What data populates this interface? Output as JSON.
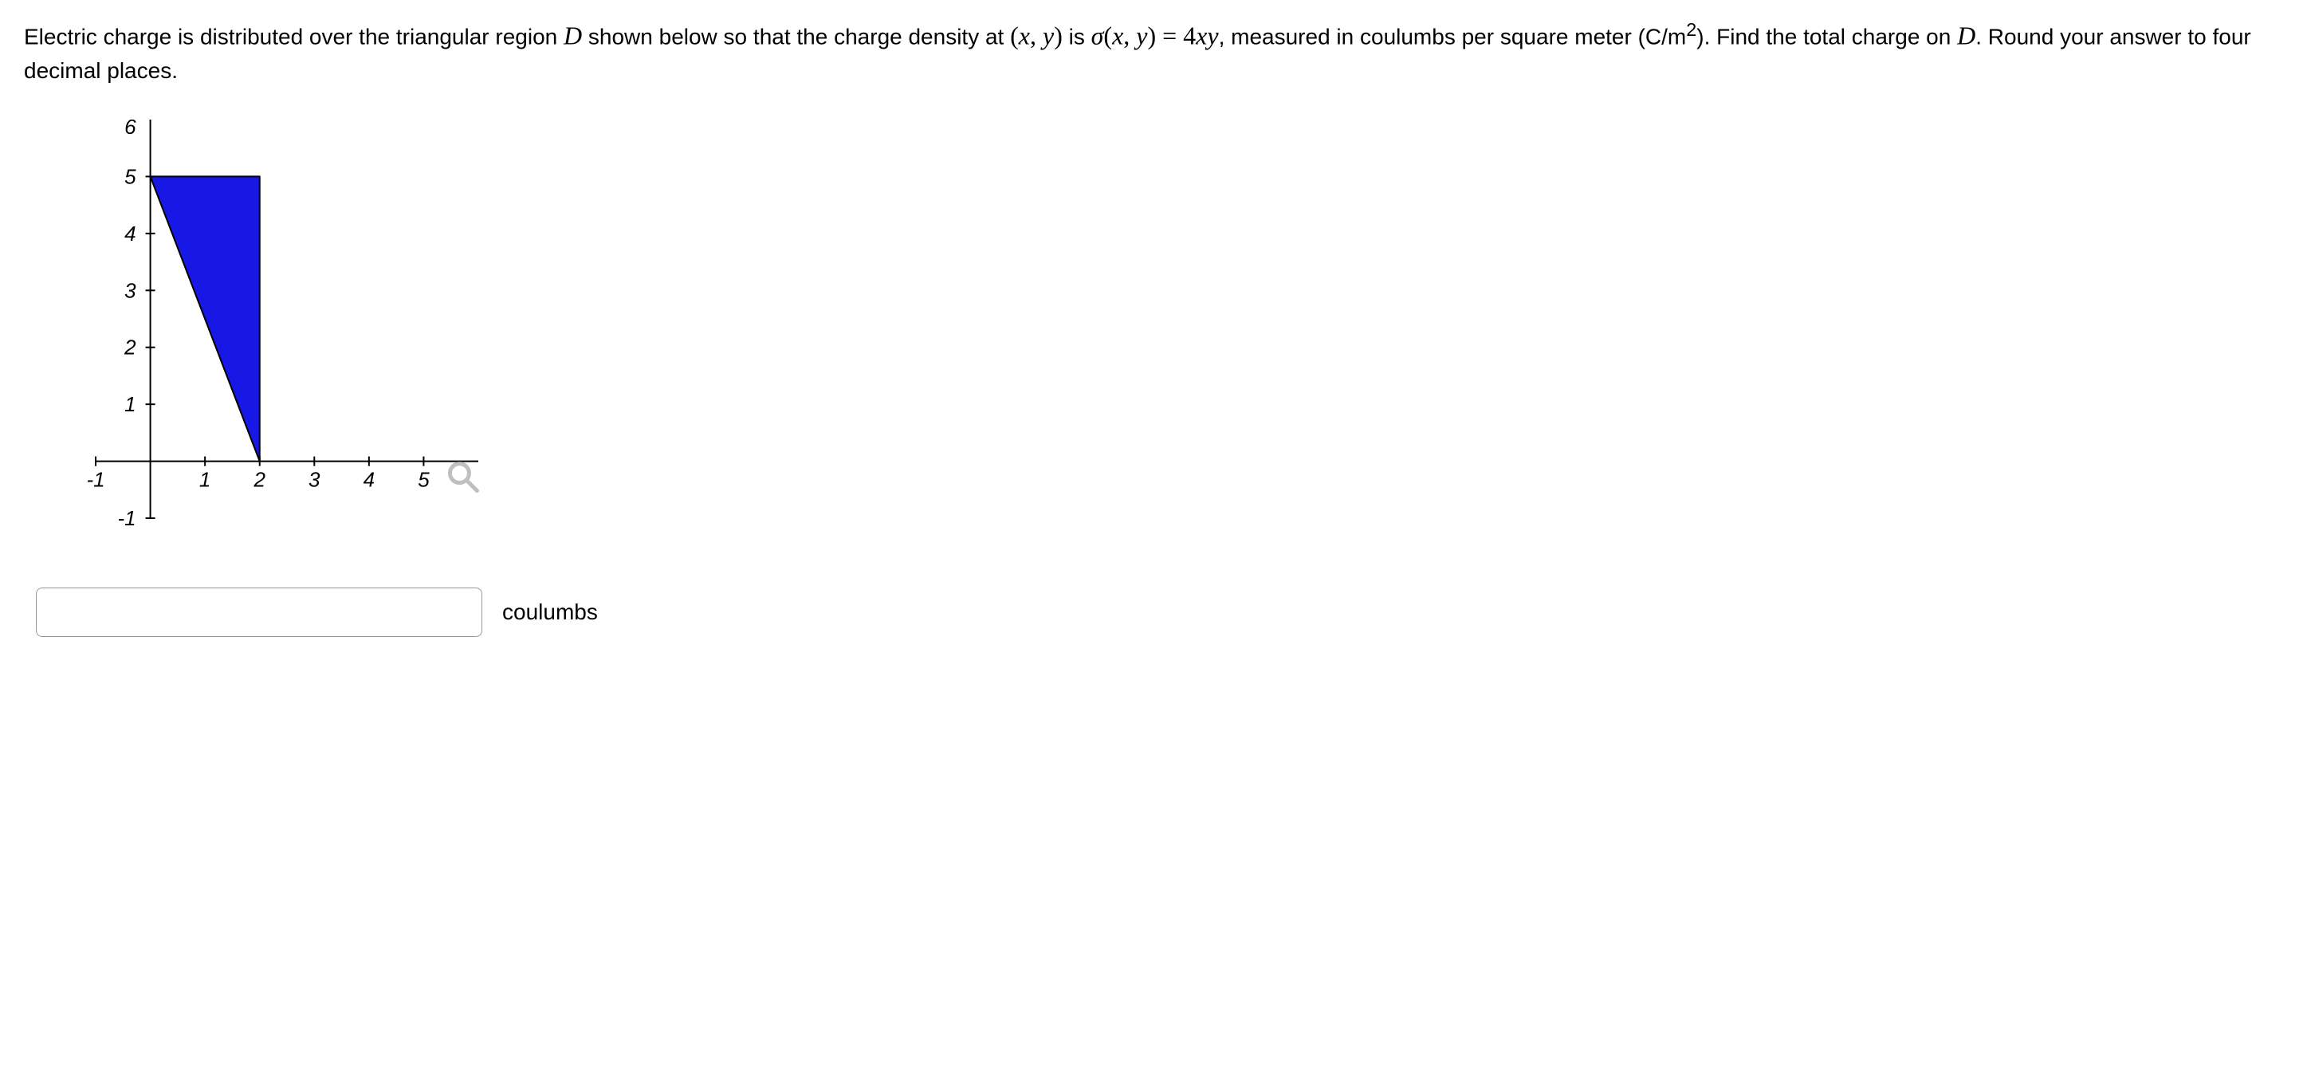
{
  "problem": {
    "part1": "Electric charge is distributed over the triangular region ",
    "D": "D",
    "part2": " shown below so that the charge density at ",
    "xy": "(x, y)",
    "part3": " is ",
    "sigma": "σ(x, y) = 4xy",
    "part4": ", measured in coulumbs per square meter (C/m",
    "sup2": "2",
    "part5": "). Find the total charge on ",
    "D2": "D",
    "part6": ".  Round your answer to four decimal places."
  },
  "answer": {
    "value": "",
    "unit": "coulumbs"
  },
  "chart_data": {
    "type": "area",
    "title": "",
    "xlabel": "",
    "ylabel": "",
    "xlim": [
      -1,
      6
    ],
    "ylim": [
      -1,
      6
    ],
    "xticks": [
      -1,
      1,
      2,
      3,
      4,
      5
    ],
    "yticks": [
      -1,
      1,
      2,
      3,
      4,
      5
    ],
    "top_y_label_clipped": "6",
    "region": {
      "name": "D",
      "vertices": [
        [
          0,
          5
        ],
        [
          2,
          5
        ],
        [
          2,
          0
        ]
      ],
      "fill": "#1818e6",
      "stroke": "#000000"
    }
  }
}
